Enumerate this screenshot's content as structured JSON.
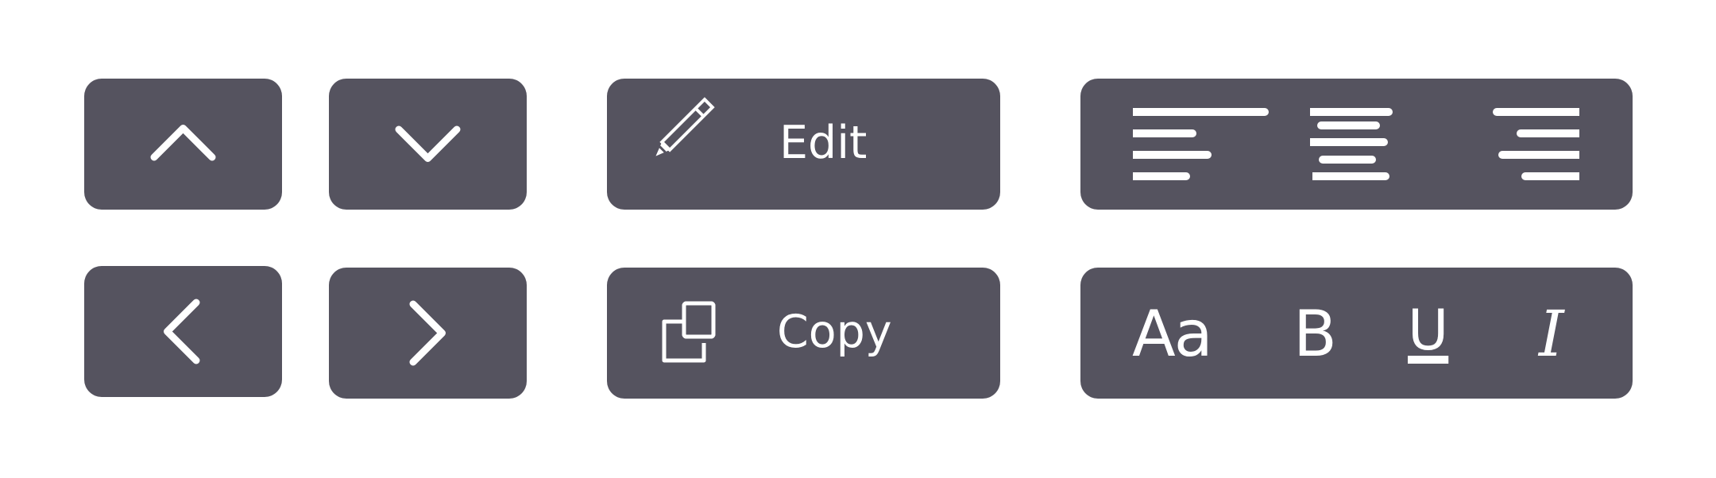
{
  "colors": {
    "page_background": "#ffffff",
    "button_background": "#55535f",
    "icon_color": "#ffffff"
  },
  "buttons": {
    "up": {
      "icon": "chevron-up-icon"
    },
    "down": {
      "icon": "chevron-down-icon"
    },
    "left": {
      "icon": "chevron-left-icon"
    },
    "right": {
      "icon": "chevron-right-icon"
    },
    "edit": {
      "icon": "pencil-icon",
      "label": "Edit"
    },
    "copy": {
      "icon": "copy-icon",
      "label": "Copy"
    },
    "alignment": {
      "icons": [
        "align-left-icon",
        "align-center-icon",
        "align-right-icon"
      ]
    },
    "text_style": {
      "font_label": "Aa",
      "bold_label": "B",
      "underline_label": "U",
      "italic_label": "I",
      "icons": [
        "font-size-icon",
        "bold-icon",
        "underline-icon",
        "italic-icon"
      ]
    }
  }
}
